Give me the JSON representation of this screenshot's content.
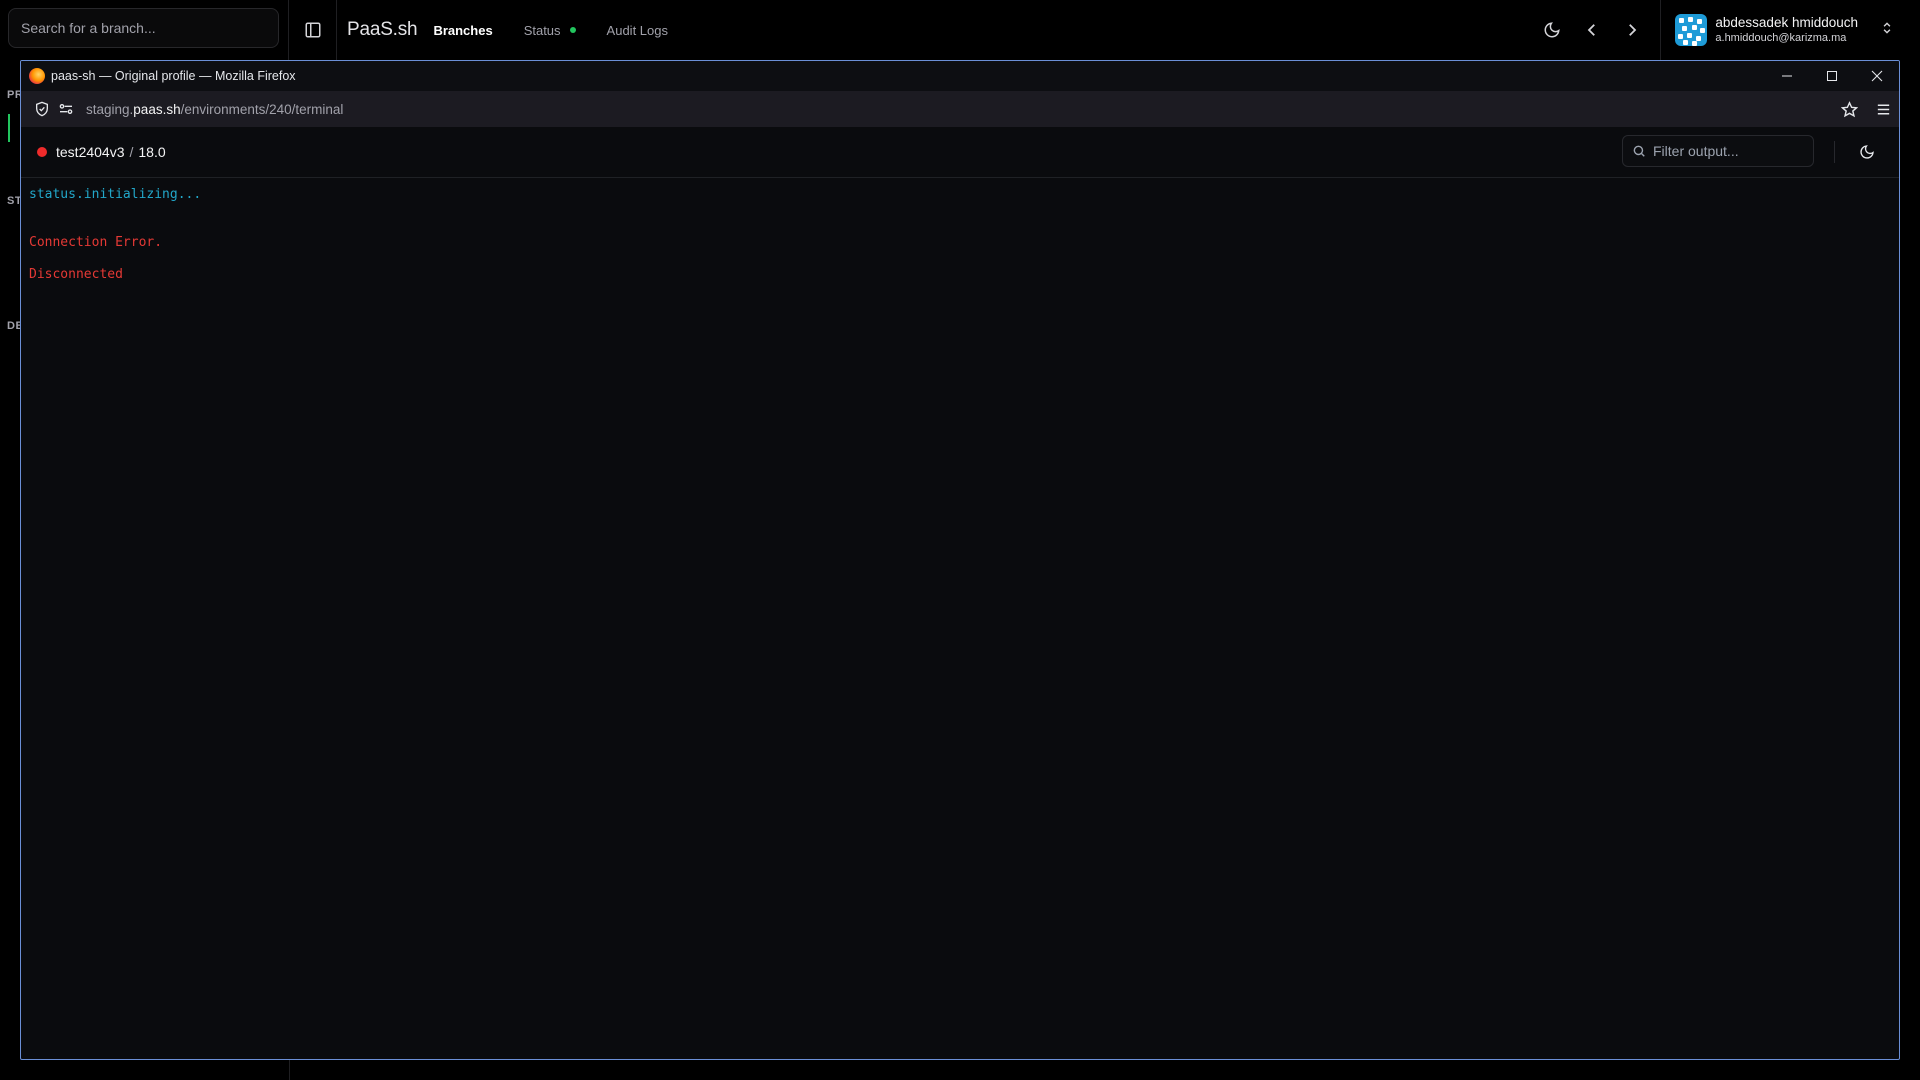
{
  "app": {
    "search_placeholder": "Search for a branch...",
    "brand": "PaaS.sh",
    "nav": {
      "branches": "Branches",
      "status": "Status",
      "audit_logs": "Audit Logs"
    },
    "status_dot_color": "#22c55e",
    "sidebar_labels": [
      "PR",
      "ST",
      "DE"
    ],
    "user": {
      "name": "abdessadek hmiddouch",
      "email": "a.hmiddouch@karizma.ma"
    }
  },
  "firefox": {
    "window_title": "paas-sh — Original profile — Mozilla Firefox",
    "url": {
      "prefix": "staging.",
      "host": "paas.sh",
      "path": "/environments/240/terminal"
    }
  },
  "terminal": {
    "env_name": "test2404v3",
    "separator": "/",
    "version": "18.0",
    "env_status_color": "#ef2b2b",
    "filter_placeholder": "Filter output...",
    "output": {
      "initializing": "status.initializing...",
      "connection_error": "Connection Error.",
      "disconnected": "Disconnected"
    }
  }
}
